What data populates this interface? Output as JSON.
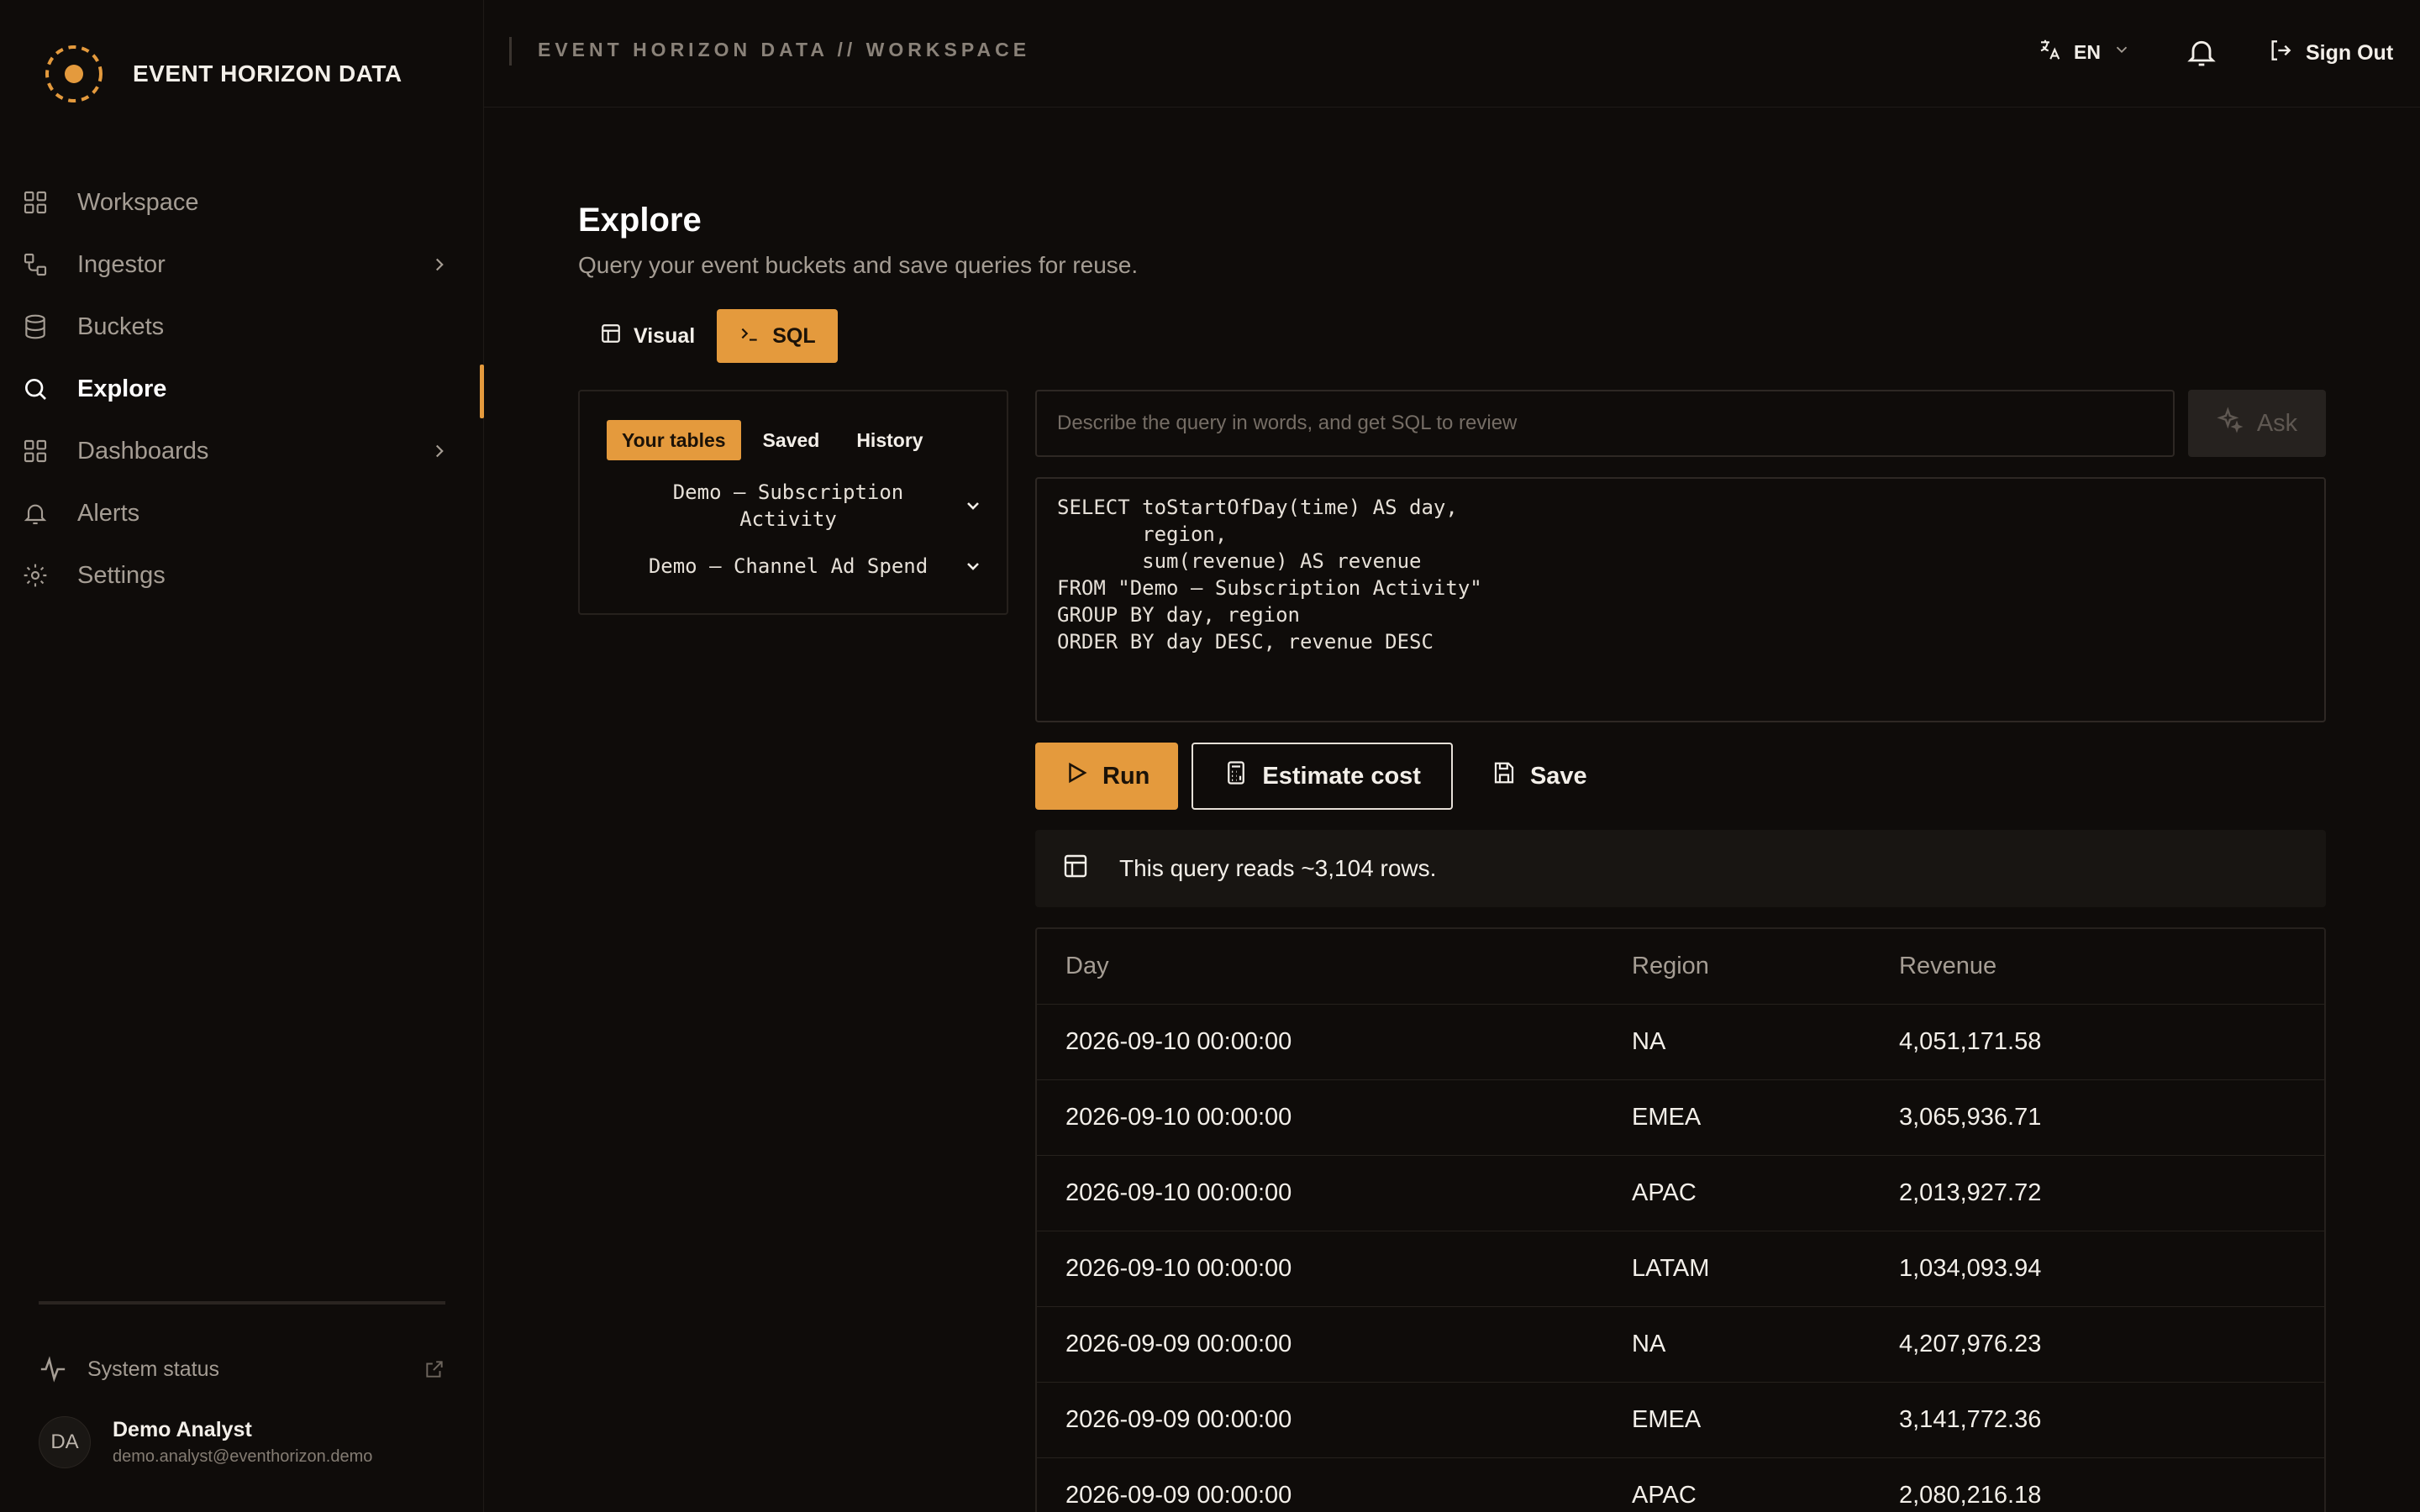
{
  "brand": {
    "name": "EVENT HORIZON DATA",
    "accent": "#e49a3d"
  },
  "nav": [
    {
      "label": "Workspace",
      "icon": "grid-icon",
      "expandable": false
    },
    {
      "label": "Ingestor",
      "icon": "workflow-icon",
      "expandable": true
    },
    {
      "label": "Buckets",
      "icon": "database-icon",
      "expandable": false
    },
    {
      "label": "Explore",
      "icon": "search-icon",
      "expandable": false,
      "active": true
    },
    {
      "label": "Dashboards",
      "icon": "grid-icon",
      "expandable": true
    },
    {
      "label": "Alerts",
      "icon": "bell-icon",
      "expandable": false
    },
    {
      "label": "Settings",
      "icon": "gear-icon",
      "expandable": false
    }
  ],
  "sidebar_footer": {
    "system_status": "System status",
    "user": {
      "initials": "DA",
      "name": "Demo Analyst",
      "email": "demo.analyst@eventhorizon.demo"
    }
  },
  "topbar": {
    "breadcrumb": "EVENT HORIZON DATA // WORKSPACE",
    "language": "EN",
    "sign_out": "Sign Out"
  },
  "page": {
    "title": "Explore",
    "subtitle": "Query your event buckets and save queries for reuse."
  },
  "mode": {
    "visual": "Visual",
    "sql": "SQL",
    "selected": "SQL"
  },
  "tables_panel": {
    "tabs": [
      "Your tables",
      "Saved",
      "History"
    ],
    "active_tab": "Your tables",
    "tables": [
      {
        "line1": "Demo — Subscription",
        "line2": "Activity"
      },
      {
        "line1": "Demo — Channel Ad Spend",
        "line2": ""
      }
    ]
  },
  "ask": {
    "placeholder": "Describe the query in words, and get SQL to review",
    "button": "Ask"
  },
  "sql": [
    "SELECT toStartOfDay(time) AS day,",
    "       region,",
    "       sum(revenue) AS revenue",
    "FROM \"Demo — Subscription Activity\"",
    "GROUP BY day, region",
    "ORDER BY day DESC, revenue DESC"
  ],
  "actions": {
    "run": "Run",
    "estimate": "Estimate cost",
    "save": "Save"
  },
  "estimate_text": "This query reads ~3,104 rows.",
  "results": {
    "columns": [
      "Day",
      "Region",
      "Revenue"
    ],
    "rows": [
      [
        "2026-09-10 00:00:00",
        "NA",
        "4,051,171.58"
      ],
      [
        "2026-09-10 00:00:00",
        "EMEA",
        "3,065,936.71"
      ],
      [
        "2026-09-10 00:00:00",
        "APAC",
        "2,013,927.72"
      ],
      [
        "2026-09-10 00:00:00",
        "LATAM",
        "1,034,093.94"
      ],
      [
        "2026-09-09 00:00:00",
        "NA",
        "4,207,976.23"
      ],
      [
        "2026-09-09 00:00:00",
        "EMEA",
        "3,141,772.36"
      ],
      [
        "2026-09-09 00:00:00",
        "APAC",
        "2,080,216.18"
      ]
    ]
  }
}
